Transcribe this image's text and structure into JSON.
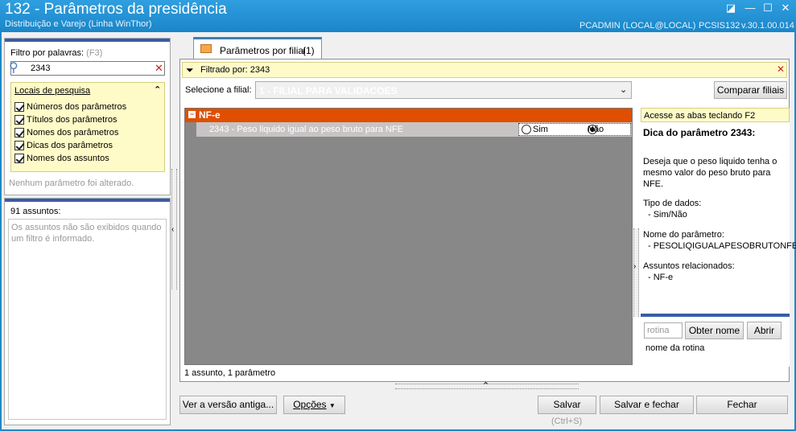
{
  "window": {
    "title": "132 - Parâmetros da presidência",
    "subtitle": "Distribuição e Varejo (Linha WinThor)",
    "user": "PCADMIN (LOCAL@LOCAL)",
    "program": "PCSIS132",
    "version": "v.30.1.00.014"
  },
  "left": {
    "filter_label": "Filtro por palavras:",
    "filter_hotkey": "(F3)",
    "search_value": "2343",
    "locais_title": "Locais de pesquisa",
    "locais": [
      "Números dos parâmetros",
      "Títulos dos parâmetros",
      "Nomes dos parâmetros",
      "Dicas dos parâmetros",
      "Nomes dos assuntos"
    ],
    "status": "Nenhum parâmetro foi alterado.",
    "assuntos_count": "91 assuntos:",
    "assuntos_info": "Os assuntos não são exibidos quando um filtro é informado."
  },
  "tab": {
    "label": "Parâmetros por filial",
    "count": "(1)"
  },
  "filter": {
    "text": "Filtrado por: 2343"
  },
  "filial": {
    "label": "Selecione a filial:",
    "value": "1 - FILIAL PARA VALIDACOES",
    "compare_button": "Comparar filiais"
  },
  "grid": {
    "group": "NF-e",
    "row": {
      "text": "2343 - Peso liquido igual ao peso bruto para NFE",
      "opt_yes": "Sim",
      "opt_no": "Não",
      "selected": "Não"
    }
  },
  "summary": "1 assunto, 1 parâmetro",
  "info": {
    "hint": "Acesse as abas teclando F2",
    "title": "Dica do parâmetro 2343:",
    "desc": "Deseja que o peso liquido tenha o mesmo valor do peso bruto para NFE.",
    "type_label": "Tipo de dados:",
    "type_value": "- Sim/Não",
    "name_label": "Nome do parâmetro:",
    "name_value": "- PESOLIQIGUALAPESOBRUTONFE",
    "assuntos_label": "Assuntos relacionados:",
    "assuntos_value": "- NF-e",
    "rotina_placeholder": "rotina",
    "get_name_button": "Obter nome",
    "open_button": "Abrir",
    "rotina_caption": "nome da rotina"
  },
  "footer": {
    "old_version": "Ver a versão antiga...",
    "options": "Opções",
    "save": "Salvar",
    "save_hotkey": "(Ctrl+S)",
    "save_close": "Salvar e fechar",
    "close": "Fechar"
  },
  "colors": {
    "titlebar": "#1d89c9",
    "accent_orange": "#e04e00",
    "highlight_yellow": "#fffbc8"
  }
}
